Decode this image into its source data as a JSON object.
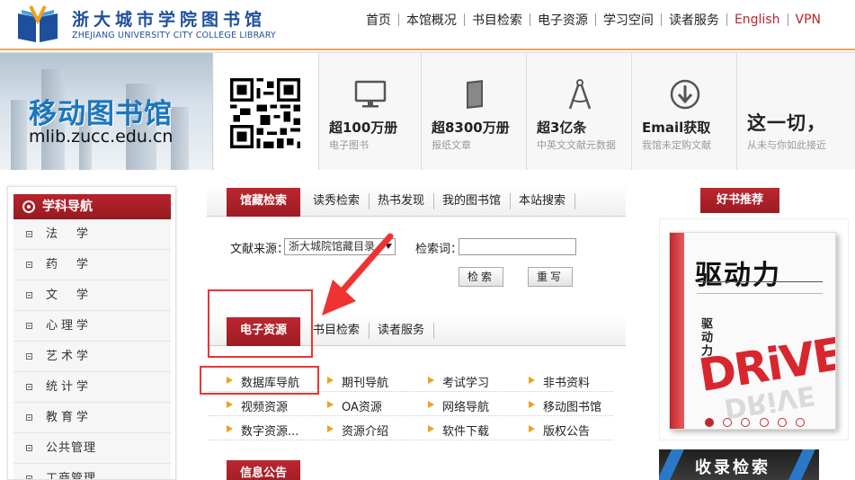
{
  "header": {
    "logo_cn": "浙大城市学院图书馆",
    "logo_en": "ZHEJIANG UNIVERSITY CITY COLLEGE LIBRARY",
    "nav": [
      "首页",
      "本馆概况",
      "书目检索",
      "电子资源",
      "学习空间",
      "读者服务"
    ],
    "nav_english": "English",
    "nav_vpn": "VPN",
    "accent_color": "#b8252b"
  },
  "banner": {
    "mobile_title": "移动图书馆",
    "mobile_url": "mlib.zucc.edu.cn",
    "stats": [
      {
        "icon": "monitor-icon",
        "main": "超100万册",
        "sub": "电子图书"
      },
      {
        "icon": "tablet-icon",
        "main": "超8300万册",
        "sub": "报纸文章"
      },
      {
        "icon": "compass-icon",
        "main": "超3亿条",
        "sub": "中英文文献元数据"
      },
      {
        "icon": "download-icon",
        "main": "Email获取",
        "sub": "我馆未定购文献"
      },
      {
        "icon": "",
        "main": "这一切，",
        "sub": "从未与你如此接近"
      }
    ]
  },
  "sidebar": {
    "title": "学科导航",
    "items": [
      "法　学",
      "药　学",
      "文　学",
      "心理学",
      "艺术学",
      "统计学",
      "教育学",
      "公共管理",
      "工商管理"
    ]
  },
  "search": {
    "tabs": [
      "馆藏检索",
      "读秀检索",
      "热书发现",
      "我的图书馆",
      "本站搜索"
    ],
    "source_label": "文献来源：",
    "source_value": "浙大城院馆藏目录",
    "keyword_label": "检索词：",
    "keyword_value": "",
    "search_button": "检索",
    "reset_button": "重写"
  },
  "resources": {
    "tabs": [
      "电子资源",
      "书目检索",
      "读者服务"
    ],
    "rows": [
      [
        "数据库导航",
        "期刊导航",
        "考试学习",
        "非书资料"
      ],
      [
        "视频资源",
        "OA资源",
        "网络导航",
        "移动图书馆"
      ],
      [
        "数字资源...",
        "资源介绍",
        "软件下载",
        "版权公告"
      ]
    ]
  },
  "info": {
    "tab": "信息公告"
  },
  "books": {
    "title": "好书推荐",
    "book_title": "驱动力",
    "book_en": "DRiVE",
    "carousel_count": 6,
    "carousel_active": 0
  },
  "collect": {
    "label": "收录检索"
  }
}
